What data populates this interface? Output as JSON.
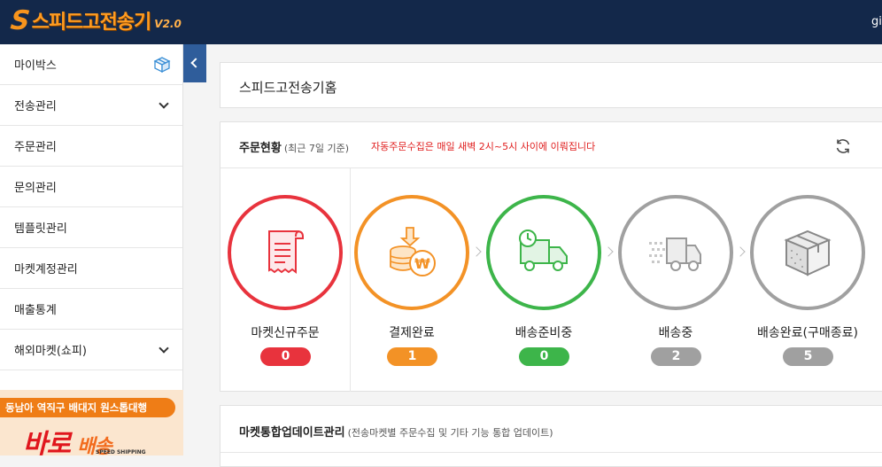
{
  "header": {
    "logo_s": "S",
    "logo_text": "스피드고전송기",
    "logo_version": "V2.0",
    "user_text": "gi"
  },
  "sidebar": {
    "items": [
      {
        "label": "마이박스",
        "icon": "box-icon"
      },
      {
        "label": "전송관리",
        "icon": "chevron-down-icon"
      },
      {
        "label": "주문관리"
      },
      {
        "label": "문의관리"
      },
      {
        "label": "템플릿관리"
      },
      {
        "label": "마켓계정관리"
      },
      {
        "label": "매출통계"
      },
      {
        "label": "해외마켓(쇼피)",
        "icon": "chevron-down-icon"
      }
    ],
    "banner": {
      "top_text": "동남아 역직구 배대지 원스톱대행",
      "big_text": "바로",
      "big_text_2": "배송",
      "sub_text": "SPEED SHIPPING"
    }
  },
  "main": {
    "page_title": "스피드고전송기홈",
    "order_status": {
      "title": "주문현황",
      "subtitle": "(최근 7일 기준)",
      "notice": "자동주문수집은 매일 새벽 2시~5시 사이에 이뤄집니다",
      "steps": [
        {
          "label": "마켓신규주문",
          "count": "0",
          "color": "#e8333d",
          "icon": "receipt-icon"
        },
        {
          "label": "결제완료",
          "count": "1",
          "color": "#f39226",
          "icon": "won-coin-icon"
        },
        {
          "label": "배송준비중",
          "count": "0",
          "color": "#3db54a",
          "icon": "truck-clock-icon"
        },
        {
          "label": "배송중",
          "count": "2",
          "color": "#a0a0a0",
          "icon": "moving-truck-icon"
        },
        {
          "label": "배송완료(구매종료)",
          "count": "5",
          "color": "#a0a0a0",
          "icon": "package-icon"
        }
      ]
    },
    "market_update": {
      "title": "마켓통합업데이트관리",
      "subtitle": "(전송마켓별 주문수집 및 기타 기능 통합 업데이트)"
    }
  }
}
